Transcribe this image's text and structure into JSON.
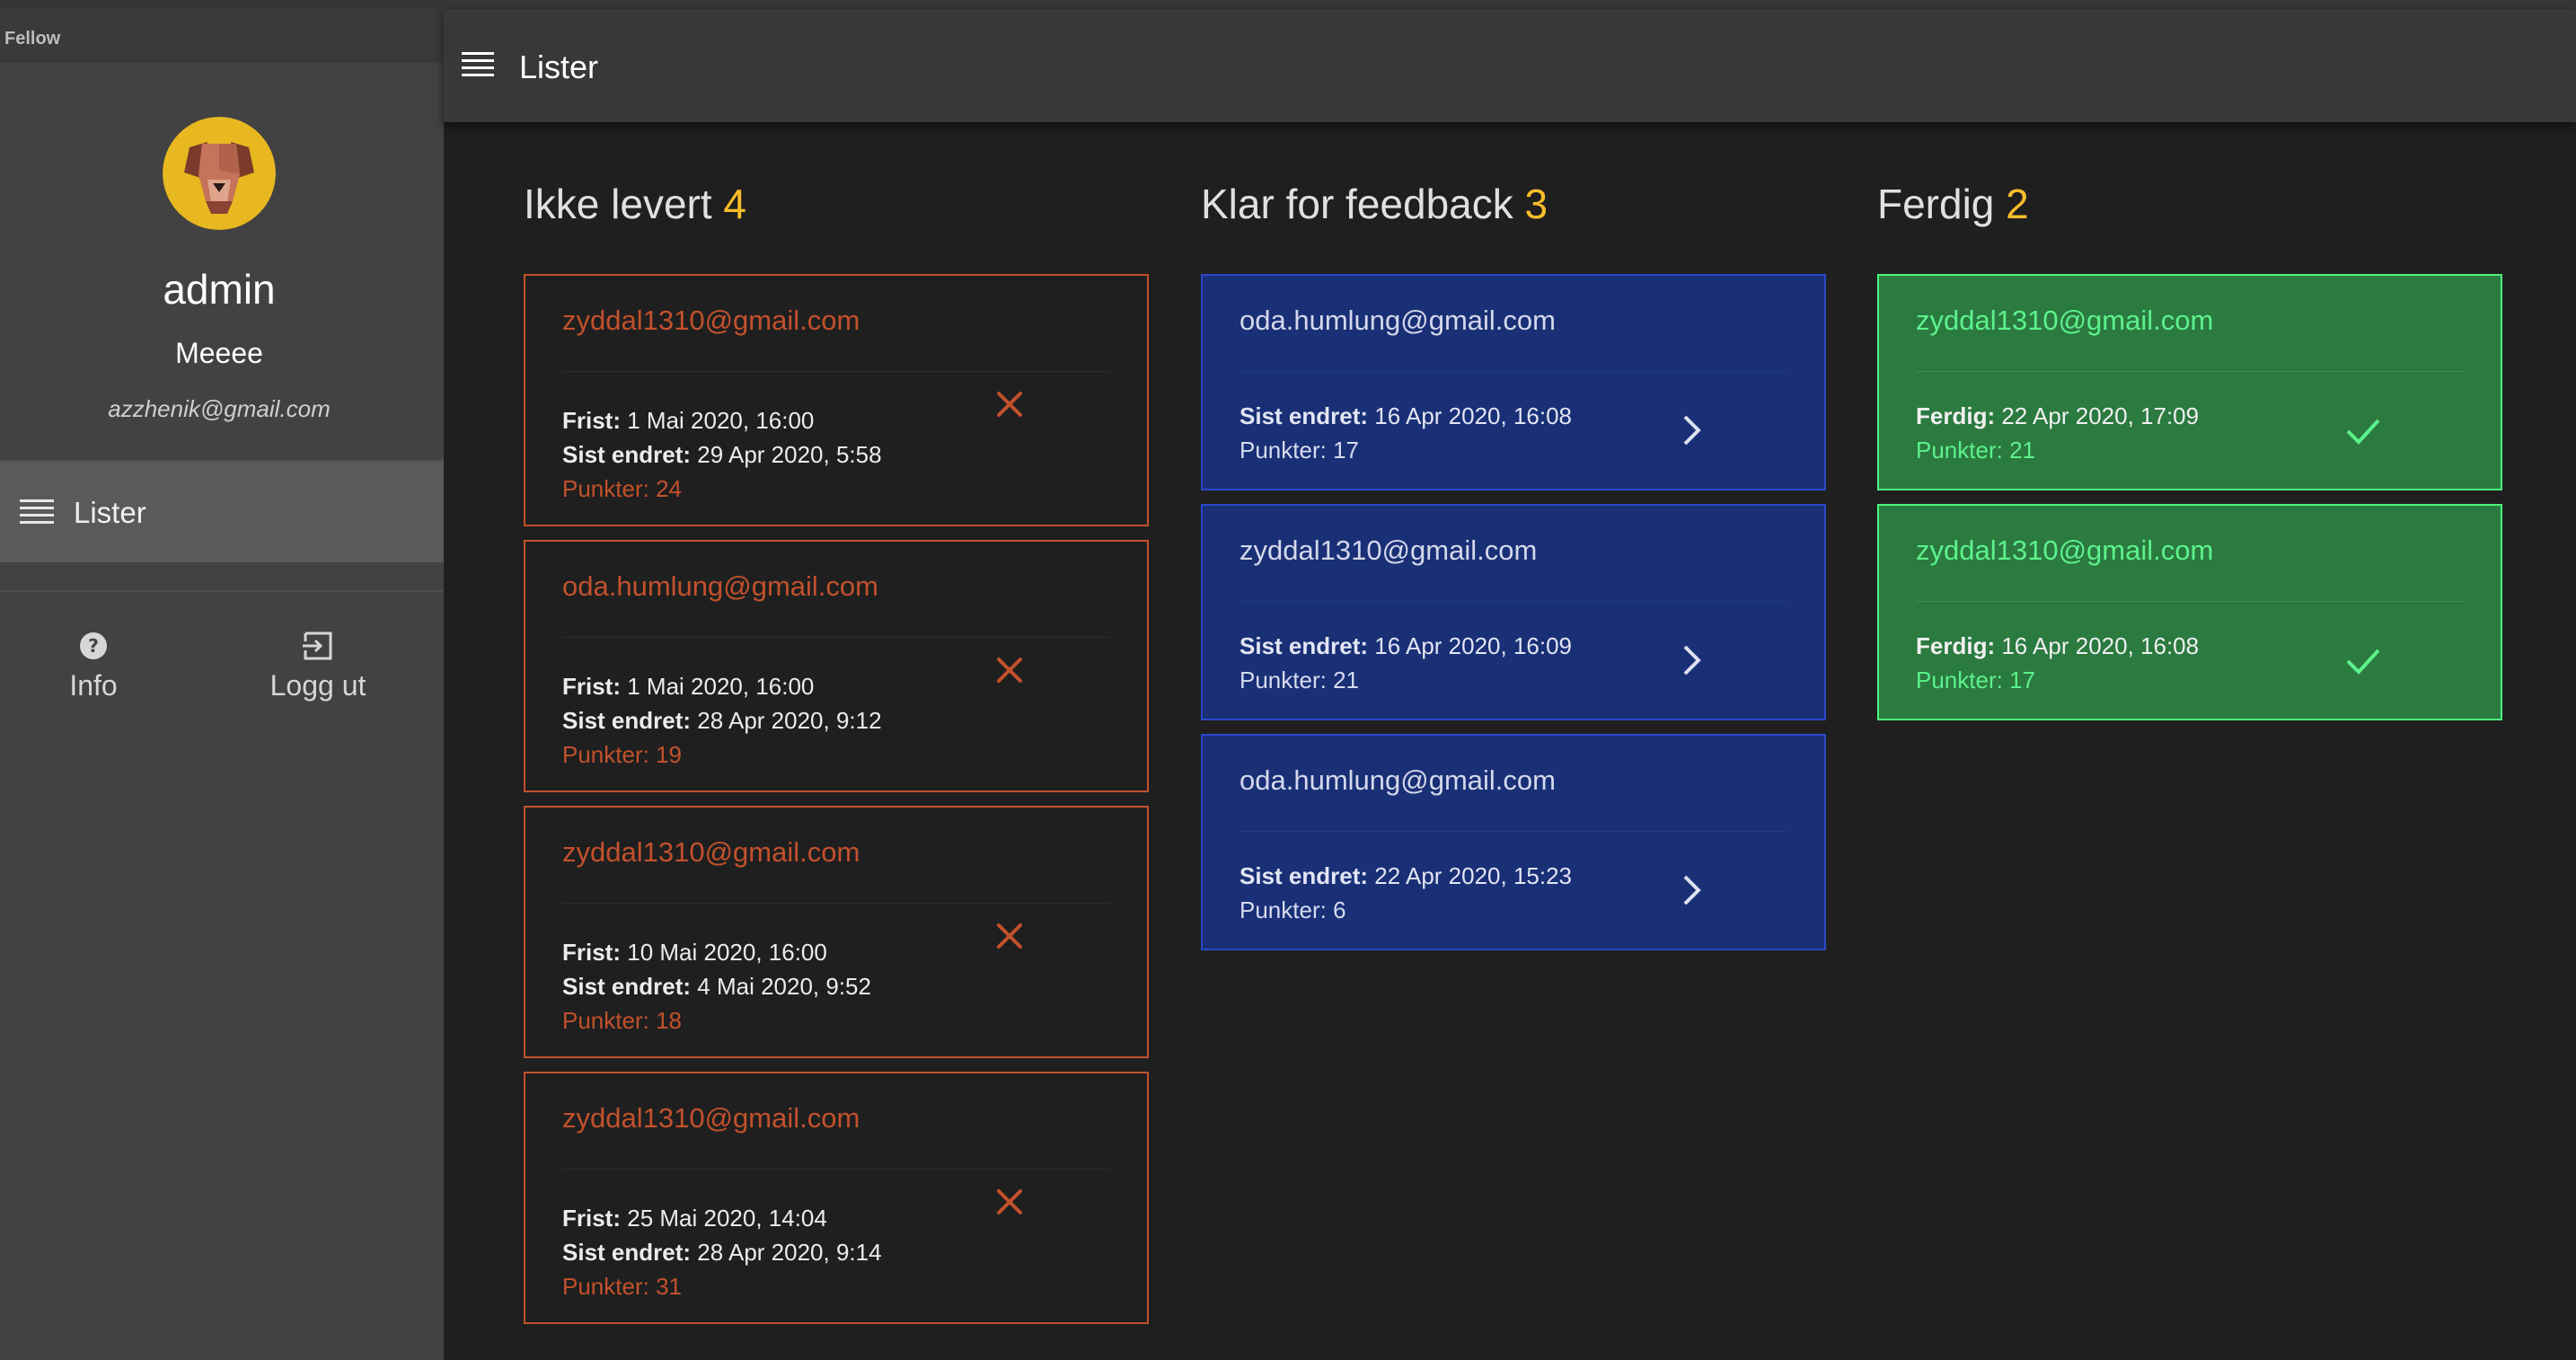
{
  "app": {
    "name": "Fellow"
  },
  "colors": {
    "accent": "#fbbe2a",
    "not_delivered": "#c2512c",
    "ready": "#192f76",
    "done": "#2b7a40",
    "done_text": "#5df28c"
  },
  "profile": {
    "name": "admin",
    "subtitle": "Meeee",
    "email": "azzhenik@gmail.com",
    "avatar_icon": "dog-avatar-icon"
  },
  "sidebar": {
    "nav": [
      {
        "label": "Lister",
        "icon": "list-icon",
        "selected": true
      }
    ],
    "actions": [
      {
        "label": "Info",
        "icon": "help-circle-icon"
      },
      {
        "label": "Logg ut",
        "icon": "logout-icon"
      }
    ]
  },
  "appbar": {
    "title": "Lister",
    "menu_icon": "list-icon"
  },
  "labels": {
    "frist": "Frist:",
    "sist_endret": "Sist endret:",
    "ferdig": "Ferdig:",
    "punkter": "Punkter:"
  },
  "columns": [
    {
      "title": "Ikke levert",
      "count": "4",
      "status_icon": "close-icon",
      "cards": [
        {
          "email": "zyddal1310@gmail.com",
          "frist": "1 Mai 2020, 16:00",
          "sist_endret": "29 Apr 2020, 5:58",
          "punkter": "24"
        },
        {
          "email": "oda.humlung@gmail.com",
          "frist": "1 Mai 2020, 16:00",
          "sist_endret": "28 Apr 2020, 9:12",
          "punkter": "19"
        },
        {
          "email": "zyddal1310@gmail.com",
          "frist": "10 Mai 2020, 16:00",
          "sist_endret": "4 Mai 2020, 9:52",
          "punkter": "18"
        },
        {
          "email": "zyddal1310@gmail.com",
          "frist": "25 Mai 2020, 14:04",
          "sist_endret": "28 Apr 2020, 9:14",
          "punkter": "31"
        }
      ]
    },
    {
      "title": "Klar for feedback",
      "count": "3",
      "status_icon": "chevron-right-icon",
      "cards": [
        {
          "email": "oda.humlung@gmail.com",
          "sist_endret": "16 Apr 2020, 16:08",
          "punkter": "17"
        },
        {
          "email": "zyddal1310@gmail.com",
          "sist_endret": "16 Apr 2020, 16:09",
          "punkter": "21"
        },
        {
          "email": "oda.humlung@gmail.com",
          "sist_endret": "22 Apr 2020, 15:23",
          "punkter": "6"
        }
      ]
    },
    {
      "title": "Ferdig",
      "count": "2",
      "status_icon": "check-icon",
      "cards": [
        {
          "email": "zyddal1310@gmail.com",
          "ferdig": "22 Apr 2020, 17:09",
          "punkter": "21"
        },
        {
          "email": "zyddal1310@gmail.com",
          "ferdig": "16 Apr 2020, 16:08",
          "punkter": "17"
        }
      ]
    }
  ]
}
